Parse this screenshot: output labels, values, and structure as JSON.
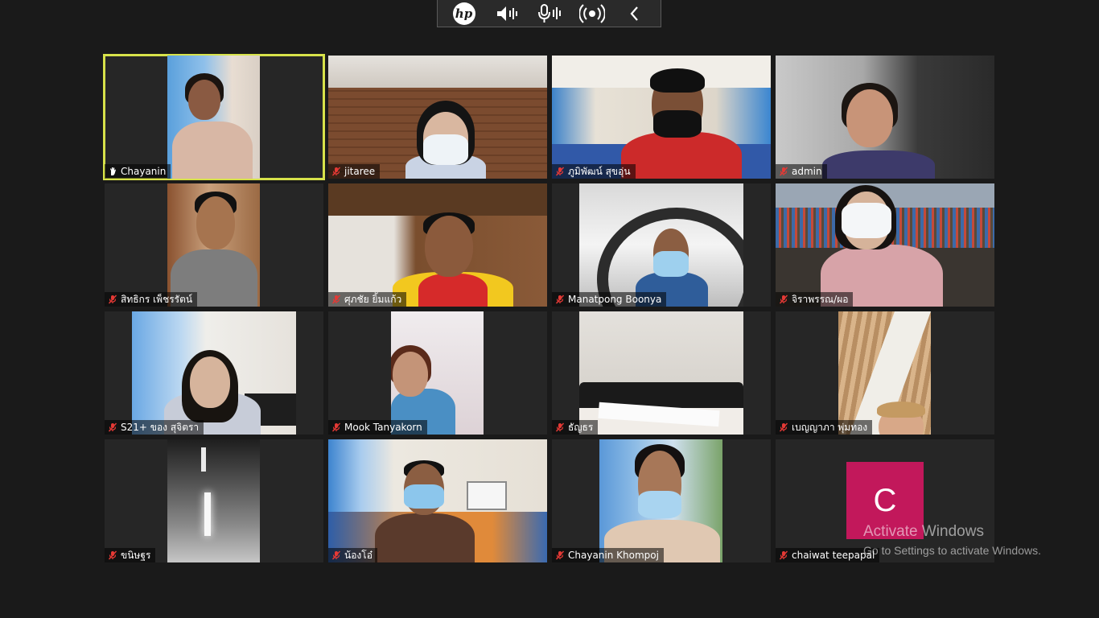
{
  "toolbar": {
    "brand_icon": "hp-logo-icon",
    "buttons": [
      {
        "icon": "speaker-icon"
      },
      {
        "icon": "microphone-icon"
      },
      {
        "icon": "broadcast-icon"
      },
      {
        "icon": "chevron-left-icon"
      }
    ]
  },
  "participants": [
    {
      "name": "Chayanin",
      "status_icon": "raised-hand-icon",
      "active": true
    },
    {
      "name": "jitaree",
      "status_icon": "mic-muted-icon"
    },
    {
      "name": "ภูมิพัฒน์ สุขอุ่น",
      "status_icon": "mic-muted-icon"
    },
    {
      "name": "admin",
      "status_icon": "mic-muted-icon"
    },
    {
      "name": "สิทธิกร เพ็ชรรัตน์",
      "status_icon": "mic-muted-icon"
    },
    {
      "name": "ศุภชัย ยิ้มแก้ว",
      "status_icon": "mic-muted-icon"
    },
    {
      "name": "Manatpong Boonya",
      "status_icon": "mic-muted-icon"
    },
    {
      "name": "จิราพรรณ/ผอ",
      "status_icon": "mic-muted-icon"
    },
    {
      "name": "S21+ ของ สุจิตรา",
      "status_icon": "mic-muted-icon"
    },
    {
      "name": "Mook Tanyakorn",
      "status_icon": "mic-muted-icon"
    },
    {
      "name": "ธัญธร",
      "status_icon": "mic-muted-icon"
    },
    {
      "name": "เบญญาภา พุ่มทอง",
      "status_icon": "mic-muted-icon"
    },
    {
      "name": "ขนิษฐร",
      "status_icon": "mic-muted-icon"
    },
    {
      "name": "น้องโอ๋",
      "status_icon": "mic-muted-icon"
    },
    {
      "name": "Chayanin Khompoj",
      "status_icon": "mic-muted-icon"
    },
    {
      "name": "chaiwat teepapal",
      "status_icon": "mic-muted-icon",
      "avatar_letter": "C",
      "avatar_color": "#c2185b"
    }
  ],
  "watermark": {
    "title": "Activate Windows",
    "subtitle": "Go to Settings to activate Windows."
  },
  "colors": {
    "background": "#1a1a1a",
    "active_speaker_border": "#d7e24a",
    "muted_mic": "#e53935"
  }
}
